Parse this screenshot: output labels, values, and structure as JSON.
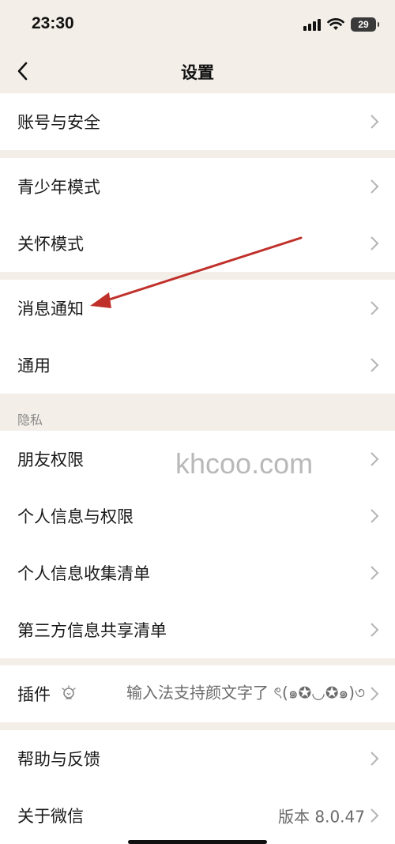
{
  "status_bar": {
    "time": "23:30",
    "battery": "29"
  },
  "nav": {
    "title": "设置"
  },
  "groups": [
    {
      "items": [
        {
          "label": "账号与安全"
        }
      ]
    },
    {
      "items": [
        {
          "label": "青少年模式"
        },
        {
          "label": "关怀模式"
        }
      ]
    },
    {
      "items": [
        {
          "label": "消息通知"
        },
        {
          "label": "通用"
        }
      ]
    },
    {
      "section": "隐私",
      "items": [
        {
          "label": "朋友权限"
        },
        {
          "label": "个人信息与权限"
        },
        {
          "label": "个人信息收集清单"
        },
        {
          "label": "第三方信息共享清单"
        }
      ]
    },
    {
      "items": [
        {
          "label": "插件",
          "value": "输入法支持颜文字了 ৎ(๑✪◡✪๑)৩"
        }
      ]
    },
    {
      "items": [
        {
          "label": "帮助与反馈"
        },
        {
          "label": "关于微信",
          "value": "版本 8.0.47"
        }
      ]
    }
  ],
  "watermark": "khcoo.com",
  "colors": {
    "background": "#f3efe8",
    "row_bg": "#ffffff",
    "annotation_arrow": "#c0302a"
  }
}
